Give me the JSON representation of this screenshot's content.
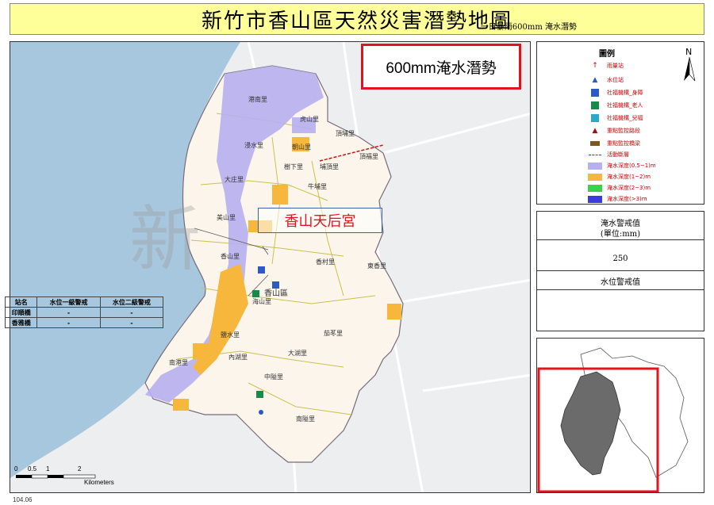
{
  "title": {
    "main": "新竹市香山區天然災害潛勢地圖",
    "sub": "一日暴雨600mm 淹水潛勢"
  },
  "map": {
    "scenario_label": "600mm淹水潛勢",
    "callout_label": "香山天后宮",
    "watermark": "新",
    "district_label": "香山區",
    "village_labels": [
      "港南里",
      "虎山里",
      "浸水里",
      "朝山里",
      "大庄里",
      "美山里",
      "香山里",
      "海山里",
      "鹽水里",
      "內湖里",
      "南港里",
      "大湖里",
      "茄苳里",
      "南隘里",
      "中隘里",
      "香村里",
      "東香里",
      "牛埔里",
      "埔頂里",
      "頂埔里",
      "頂福里",
      "樹下里"
    ],
    "scale": {
      "ticks": [
        "0",
        "0.5",
        "1",
        "2"
      ],
      "unit": "Kilometers"
    },
    "date": "104.06"
  },
  "legend": {
    "title": "圖例",
    "items": [
      {
        "label": "雨量站",
        "symbol": "rain-station-icon"
      },
      {
        "label": "水位站",
        "symbol": "water-level-icon"
      },
      {
        "label": "社福機構_身障",
        "symbol": "disabled-facility-icon"
      },
      {
        "label": "社福機構_老人",
        "symbol": "elderly-facility-icon"
      },
      {
        "label": "社福機構_兒福",
        "symbol": "child-facility-icon"
      },
      {
        "label": "重點監控路段",
        "symbol": "monitored-road-icon"
      },
      {
        "label": "重點監控橋梁",
        "symbol": "monitored-bridge-icon"
      },
      {
        "label": "活動斷層",
        "symbol": "active-fault-icon"
      }
    ],
    "depths": [
      {
        "label": "淹水深度(0.5~1)m",
        "color": "#b7b0f0"
      },
      {
        "label": "淹水深度(1~2)m",
        "color": "#f6b73c"
      },
      {
        "label": "淹水深度(2~3)m",
        "color": "#3cd14a"
      },
      {
        "label": "淹水深度(>3)m",
        "color": "#3b3be0"
      }
    ],
    "north": "N"
  },
  "warning": {
    "flood_title": "淹水警戒值",
    "flood_unit": "(單位:mm)",
    "flood_value": "250",
    "water_title": "水位警戒值",
    "headers": [
      "站名",
      "水位一級警戒",
      "水位二級警戒"
    ],
    "rows": [
      [
        "印順橋",
        "-",
        "-"
      ],
      [
        "香雅橋",
        "-",
        "-"
      ]
    ]
  },
  "colors": {
    "title_bg": "#ffff99",
    "highlight": "#e0141e",
    "callout_border": "#3b5fa8",
    "sea": "#a7c7de",
    "district": "#fdf6ec",
    "inset_fill": "#6b6b6b"
  }
}
